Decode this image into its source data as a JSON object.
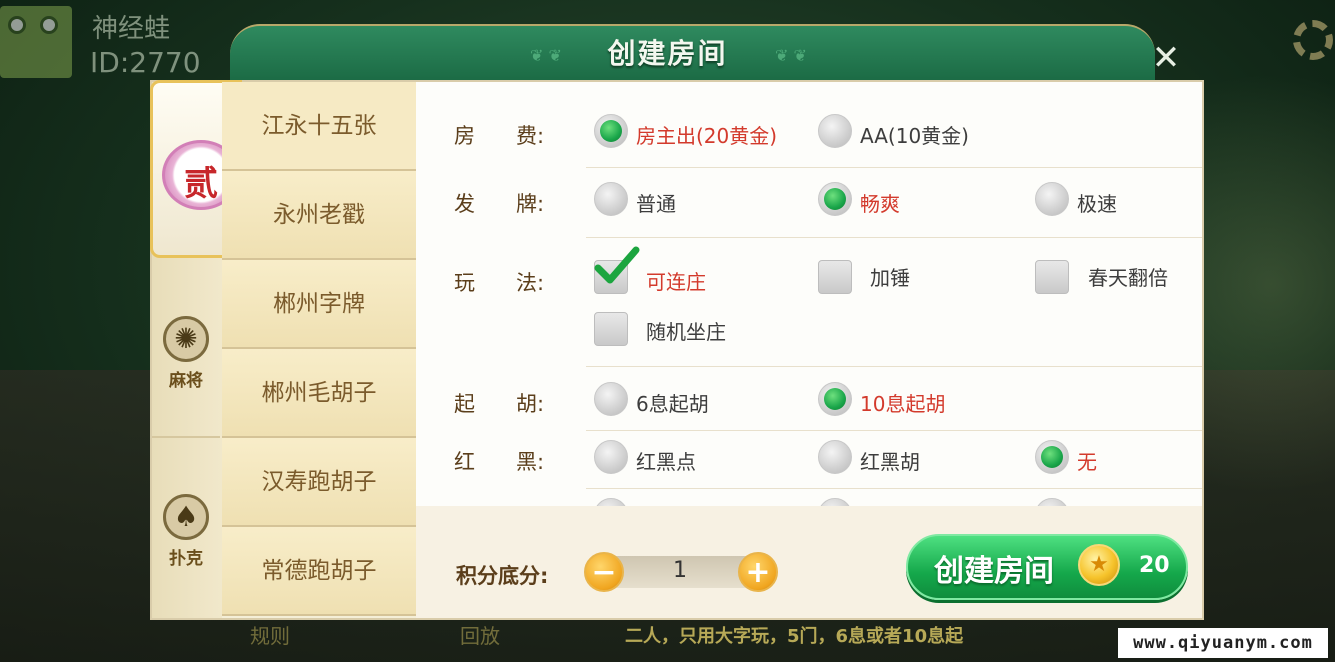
{
  "background": {
    "player_name": "神经蛙",
    "player_id": "ID:2770",
    "footer_btn1": "规则",
    "footer_btn2": "回放",
    "footer_desc": "二人，只用大字玩，5门，6息或者10息起"
  },
  "dialog": {
    "title": "创建房间",
    "close_icon": "close-icon"
  },
  "categories": {
    "active_badge": "贰",
    "mahjong_label": "麻将",
    "poker_label": "扑克"
  },
  "games": [
    "江永十五张",
    "永州老戳",
    "郴州字牌",
    "郴州毛胡子",
    "汉寿跑胡子",
    "常德跑胡子"
  ],
  "options": {
    "fee": {
      "label_a": "房",
      "label_b": "费:",
      "choices": [
        "房主出(20黄金)",
        "AA(10黄金)"
      ],
      "selected": 0
    },
    "deal": {
      "label_a": "发",
      "label_b": "牌:",
      "choices": [
        "普通",
        "畅爽",
        "极速"
      ],
      "selected": 1
    },
    "rules": {
      "label_a": "玩",
      "label_b": "法:",
      "choices": [
        "可连庄",
        "加锤",
        "春天翻倍",
        "随机坐庄"
      ],
      "checked": [
        true,
        false,
        false,
        false
      ]
    },
    "start_hu": {
      "label_a": "起",
      "label_b": "胡:",
      "choices": [
        "6息起胡",
        "10息起胡"
      ],
      "selected": 1
    },
    "red_black": {
      "label_a": "红",
      "label_b": "黑:",
      "choices": [
        "红黑点",
        "红黑胡",
        "无"
      ],
      "selected": 2
    }
  },
  "score": {
    "label": "积分底分:",
    "value": "1",
    "minus": "−",
    "plus": "+"
  },
  "create_button": {
    "label": "创建房间",
    "cost": "20",
    "coin_glyph": "★"
  },
  "watermark": "www.qiyuanym.com"
}
